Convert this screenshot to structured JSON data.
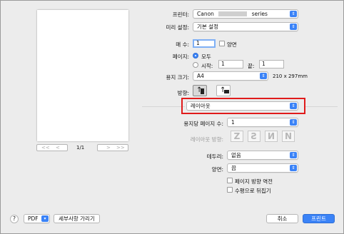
{
  "printer": {
    "label": "프린터:",
    "value_left": "Canon",
    "value_right": "series"
  },
  "presets": {
    "label": "미리 설정:",
    "value": "기본 설정"
  },
  "copies": {
    "label": "매 수:",
    "value": "1",
    "duplex_label": "양면"
  },
  "pages": {
    "label": "페이지:",
    "all_label": "모두",
    "from_label": "시작:",
    "from_value": "1",
    "to_label": "끝:",
    "to_value": "1"
  },
  "paper_size": {
    "label": "용지 크기:",
    "value": "A4",
    "dimensions": "210 x 297mm"
  },
  "orientation": {
    "label": "방향:"
  },
  "section": {
    "value": "레이아웃"
  },
  "layout": {
    "pages_per_sheet_label": "용지당 페이지 수:",
    "pages_per_sheet_value": "1",
    "direction_label": "레이아웃 방향:",
    "border_label": "테두리:",
    "border_value": "없음",
    "two_sided_label": "양면:",
    "two_sided_value": "끔",
    "reverse_orientation_label": "페이지 방향 역전",
    "flip_horizontal_label": "수평으로 뒤집기"
  },
  "preview": {
    "page_indicator": "1/1"
  },
  "footer": {
    "help_glyph": "?",
    "pdf_label": "PDF",
    "hide_details_label": "세부사항 가리기",
    "cancel_label": "취소",
    "print_label": "프린트"
  },
  "colors": {
    "accent": "#3b83f7",
    "highlight_box": "#e01b1b",
    "dialog_bg": "#ececec"
  }
}
